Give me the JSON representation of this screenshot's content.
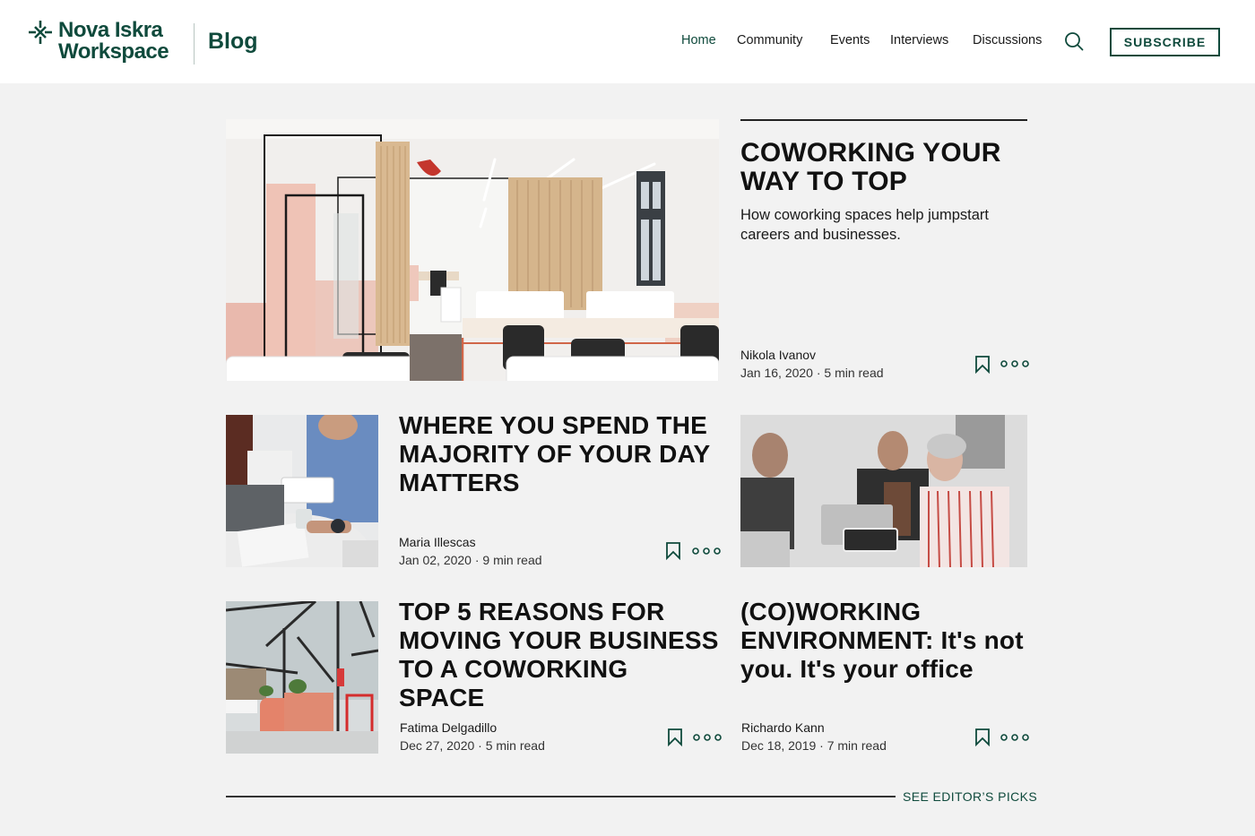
{
  "brand": {
    "name_line1": "Nova Iskra",
    "name_line2": "Workspace",
    "section": "Blog",
    "logo_icon": "spark-asterisk-icon",
    "color_primary": "#0f4a3c"
  },
  "nav": {
    "items": [
      {
        "label": "Home",
        "active": true
      },
      {
        "label": "Community",
        "active": false
      },
      {
        "label": "Events",
        "active": false
      },
      {
        "label": "Interviews",
        "active": false
      },
      {
        "label": "Discussions",
        "active": false
      }
    ],
    "search_icon": "search-icon",
    "subscribe_label": "SUBSCRIBE"
  },
  "featured": {
    "title_line1": "COWORKING YOUR",
    "title_line2": "WAY TO TOP",
    "subtitle_line1": "How coworking spaces help jumpstart",
    "subtitle_line2": "careers and businesses.",
    "author": "Nikola Ivanov",
    "date_read": "Jan 16, 2020 · 5 min read",
    "image": "office interior with glass rooms, curtains and desks"
  },
  "articles": [
    {
      "title_lines": [
        "WHERE YOU SPEND THE",
        "MAJORITY OF YOUR DAY",
        "MATTERS"
      ],
      "author": "Maria Illescas",
      "date_read": "Jan 02, 2020 · 9 min read",
      "image": "people with laptop and tablet at table"
    },
    {
      "title_lines": [],
      "author": "",
      "date_read": "",
      "image": "three smiling coworkers with laptops"
    },
    {
      "title_lines": [
        "TOP 5 REASONS FOR",
        "MOVING YOUR BUSINESS",
        "TO A COWORKING",
        "SPACE"
      ],
      "author": "Fatima Delgadillo",
      "date_read": "Dec 27, 2020 · 5 min read",
      "image": "glass atrium with pink reception desk"
    },
    {
      "title_lines": [
        "(CO)WORKING",
        "ENVIRONMENT: It's not",
        "you. It's your office"
      ],
      "author": "Richardo Kann",
      "date_read": "Dec 18, 2019 · 7 min read",
      "image": ""
    }
  ],
  "footer": {
    "editors_picks": "SEE EDITOR’S PICKS"
  }
}
